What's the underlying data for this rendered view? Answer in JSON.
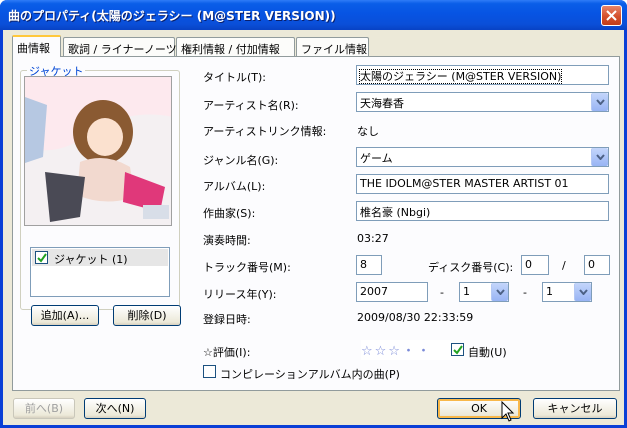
{
  "window": {
    "title": "曲のプロパティ(太陽のジェラシー (M@STER VERSION))"
  },
  "tabs": [
    {
      "label": "曲情報",
      "active": true
    },
    {
      "label": "歌詞 / ライナーノーツ",
      "active": false
    },
    {
      "label": "権利情報 / 付加情報",
      "active": false
    },
    {
      "label": "ファイル情報",
      "active": false
    }
  ],
  "jacket": {
    "group_label": "ジャケット",
    "list_item": "ジャケット (1)",
    "list_item_checked": true,
    "add_button": "追加(A)...",
    "delete_button": "削除(D)"
  },
  "fields": {
    "title": {
      "label": "タイトル(T):",
      "value": "太陽のジェラシー (M@STER VERSION)"
    },
    "artist": {
      "label": "アーティスト名(R):",
      "value": "天海春香"
    },
    "artist_link": {
      "label": "アーティストリンク情報:",
      "value": "なし"
    },
    "genre": {
      "label": "ジャンル名(G):",
      "value": "ゲーム"
    },
    "album": {
      "label": "アルバム(L):",
      "value": "THE IDOLM@STER MASTER ARTIST 01"
    },
    "composer": {
      "label": "作曲家(S):",
      "value": "椎名豪 (Nbgi)"
    },
    "duration": {
      "label": "演奏時間:",
      "value": "03:27"
    },
    "track": {
      "label": "トラック番号(M):",
      "value": "8"
    },
    "disc": {
      "label": "ディスク番号(C):",
      "value": "0",
      "total": "0",
      "separator": "/"
    },
    "release": {
      "label": "リリース年(Y):",
      "year": "2007",
      "dash1": "-",
      "month": "1",
      "dash2": "-",
      "day": "1"
    },
    "registered": {
      "label": "登録日時:",
      "value": "2009/08/30 22:33:59"
    },
    "rating": {
      "label": "☆評価(I):",
      "stars": "☆☆☆・・",
      "auto_label": "自動(U)",
      "auto_checked": true
    },
    "compilation": {
      "label": "コンピレーションアルバム内の曲(P)",
      "checked": false
    }
  },
  "buttons": {
    "prev": "前へ(B)",
    "next": "次へ(N)",
    "ok": "OK",
    "cancel": "キャンセル"
  },
  "colors": {
    "titlebar": "#0754e3",
    "dialog_bg": "#ece9d8",
    "group_label": "#0046d5",
    "tab_highlight": "#ffc83c"
  }
}
